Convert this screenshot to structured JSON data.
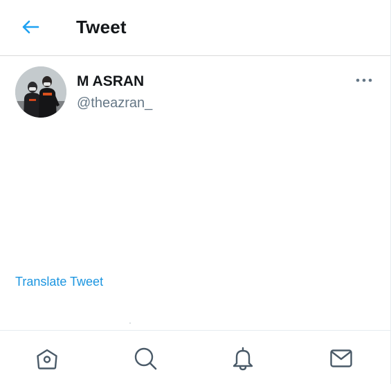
{
  "header": {
    "title": "Tweet",
    "back_icon": "arrow-left-icon"
  },
  "tweet": {
    "author_name": "M ASRAN",
    "author_handle": "@theazran_",
    "more_icon": "more-horizontal-icon",
    "translate_label": "Translate Tweet"
  },
  "bottom_nav": {
    "items": [
      {
        "icon": "home-icon"
      },
      {
        "icon": "search-icon"
      },
      {
        "icon": "bell-icon"
      },
      {
        "icon": "mail-icon"
      }
    ]
  },
  "colors": {
    "accent": "#1da1f2",
    "link": "#1b95e0",
    "secondary_text": "#657786",
    "icon_gray": "#4a5a68"
  }
}
